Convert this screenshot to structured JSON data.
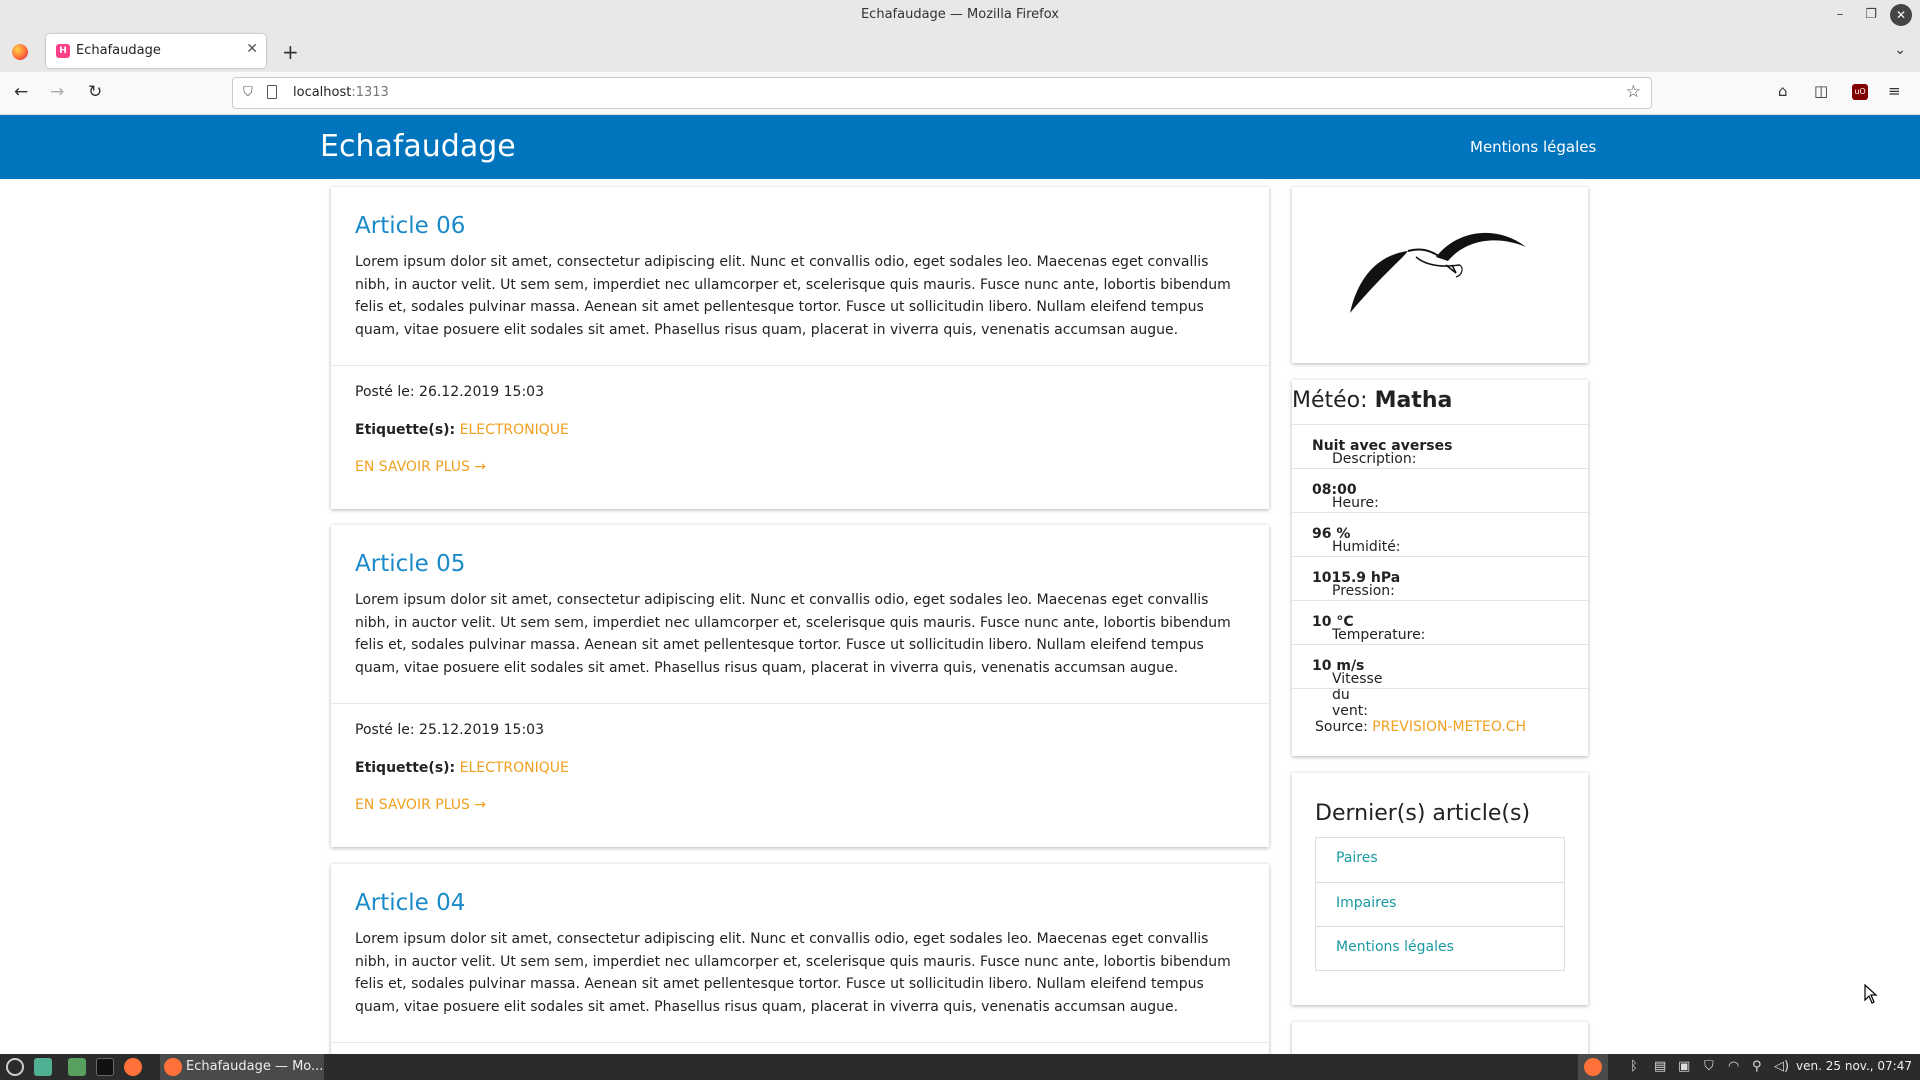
{
  "browser": {
    "window_title": "Echafaudage — Mozilla Firefox",
    "tab_title": "Echafaudage",
    "url_host": "localhost",
    "url_port": ":1313"
  },
  "site": {
    "brand": "Echafaudage",
    "nav_link": "Mentions légales"
  },
  "articles": [
    {
      "title": "Article 06",
      "body": "Lorem ipsum dolor sit amet, consectetur adipiscing elit. Nunc et convallis odio, eget sodales leo. Maecenas eget convallis nibh, in auctor velit. Ut sem sem, imperdiet nec ullamcorper et, scelerisque quis mauris. Fusce nunc ante, lobortis bibendum felis et, sodales pulvinar massa. Aenean sit amet pellentesque tortor. Fusce ut sollicitudin libero. Nullam eleifend tempus quam, vitae posuere elit sodales sit amet. Phasellus risus quam, placerat in viverra quis, venenatis accumsan augue.",
      "posted_label": "Posté le:",
      "posted_date": "26.12.2019 15:03",
      "tags_label": "Etiquette(s):",
      "tag": "ELECTRONIQUE",
      "more": "EN SAVOIR PLUS →"
    },
    {
      "title": "Article 05",
      "body": "Lorem ipsum dolor sit amet, consectetur adipiscing elit. Nunc et convallis odio, eget sodales leo. Maecenas eget convallis nibh, in auctor velit. Ut sem sem, imperdiet nec ullamcorper et, scelerisque quis mauris. Fusce nunc ante, lobortis bibendum felis et, sodales pulvinar massa. Aenean sit amet pellentesque tortor. Fusce ut sollicitudin libero. Nullam eleifend tempus quam, vitae posuere elit sodales sit amet. Phasellus risus quam, placerat in viverra quis, venenatis accumsan augue.",
      "posted_label": "Posté le:",
      "posted_date": "25.12.2019 15:03",
      "tags_label": "Etiquette(s):",
      "tag": "ELECTRONIQUE",
      "more": "EN SAVOIR PLUS →"
    },
    {
      "title": "Article 04",
      "body": "Lorem ipsum dolor sit amet, consectetur adipiscing elit. Nunc et convallis odio, eget sodales leo. Maecenas eget convallis nibh, in auctor velit. Ut sem sem, imperdiet nec ullamcorper et, scelerisque quis mauris. Fusce nunc ante, lobortis bibendum felis et, sodales pulvinar massa. Aenean sit amet pellentesque tortor. Fusce ut sollicitudin libero. Nullam eleifend tempus quam, vitae posuere elit sodales sit amet. Phasellus risus quam, placerat in viverra quis, venenatis accumsan augue."
    }
  ],
  "weather": {
    "title_prefix": "Météo:",
    "city": "Matha",
    "rows": [
      {
        "label": "Description:",
        "value": "Nuit avec averses"
      },
      {
        "label": "Heure:",
        "value": "08:00"
      },
      {
        "label": "Humidité:",
        "value": "96 %"
      },
      {
        "label": "Pression:",
        "value": "1015.9 hPa"
      },
      {
        "label": "Temperature:",
        "value": "10 °C"
      },
      {
        "label": "Vitesse du vent:",
        "value": "10 m/s"
      }
    ],
    "source_label": "Source:",
    "source_link": "PREVISION-METEO.CH"
  },
  "latest": {
    "title": "Dernier(s) article(s)",
    "items": [
      "Paires",
      "Impaires",
      "Mentions légales"
    ]
  },
  "taskbar": {
    "window_label": "Echafaudage — Mo...",
    "clock": "ven. 25 nov., 07:47"
  },
  "colors": {
    "header_blue": "#0075be",
    "link_blue": "#1a8ac9",
    "accent_orange": "#f0a020",
    "teal_link": "#1a9aa0"
  }
}
